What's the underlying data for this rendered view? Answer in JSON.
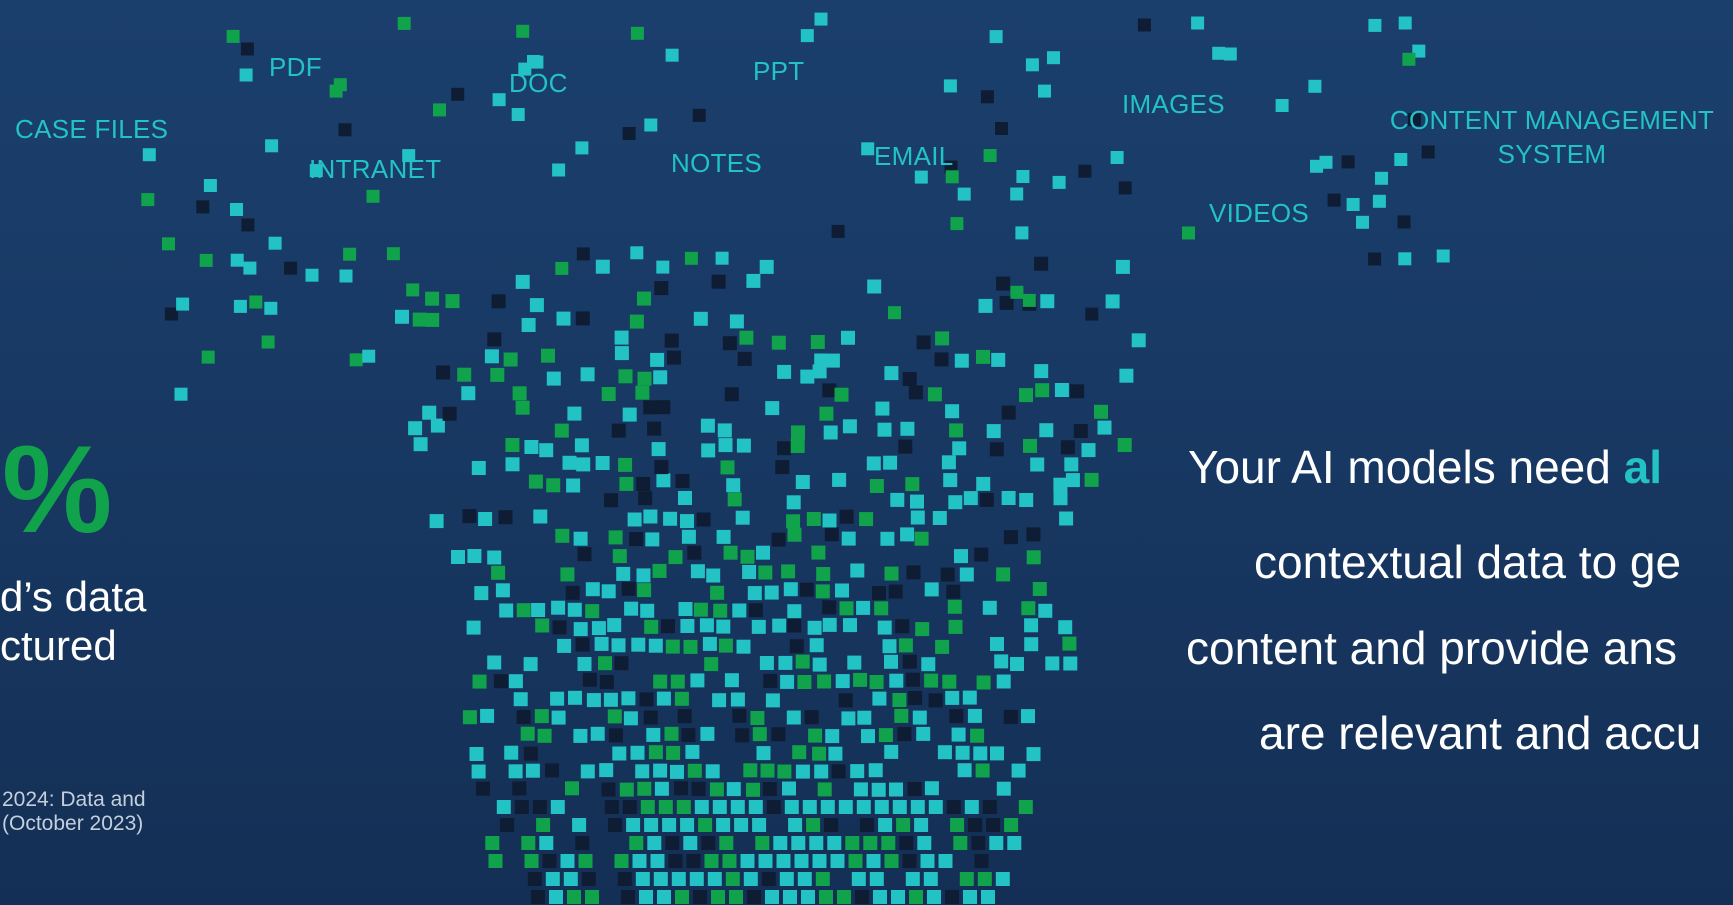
{
  "labels": {
    "case_files": "CASE FILES",
    "pdf": "PDF",
    "intranet": "INTRANET",
    "doc": "DOC",
    "notes": "NOTES",
    "ppt": "PPT",
    "email": "EMAIL",
    "images": "IMAGES",
    "cms_line1": "CONTENT MANAGEMENT",
    "cms_line2": "SYSTEM",
    "videos": "VIDEOS"
  },
  "stat": {
    "percent_fragment": "%",
    "line1": "d’s data",
    "line2": "ctured"
  },
  "source": {
    "line1": "2024: Data and",
    "line2": "(October 2023)"
  },
  "tagline": {
    "line1_prefix": "Your AI models need ",
    "line1_accent": "al",
    "line2": "contextual data to ge",
    "line3": "content and provide ans",
    "line4": "are relevant and accu"
  },
  "colors": {
    "background_top": "#1b3f6d",
    "background_bottom": "#142f55",
    "cyan": "#23c2c4",
    "green": "#11a24c",
    "dark": "#0e1d33",
    "text": "#ffffff"
  }
}
